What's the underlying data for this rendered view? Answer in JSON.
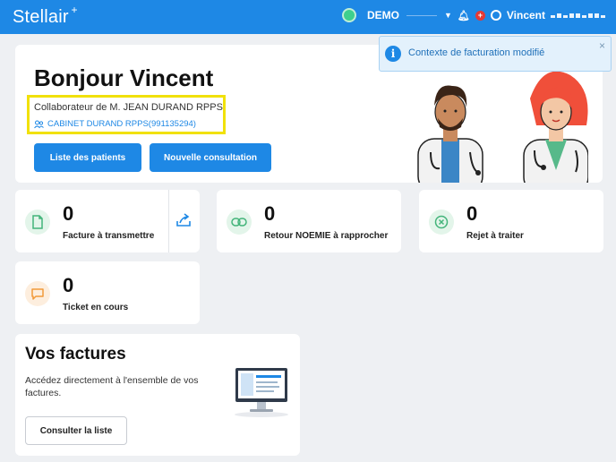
{
  "header": {
    "logo": "Stellair",
    "logo_spark": "+",
    "env_name": "DEMO",
    "user_name": "Vincent",
    "colors": {
      "bar": "#1e88e5",
      "env_dot": "#3ecf8e"
    }
  },
  "toast": {
    "text": "Contexte de facturation modifié",
    "close": "×"
  },
  "welcome": {
    "greeting": "Bonjour Vincent",
    "collaborator": "Collaborateur de M. JEAN DURAND RPPS",
    "cabinet": "CABINET DURAND RPPS(991135294)",
    "btn_patients": "Liste des patients",
    "btn_consultation": "Nouvelle consultation"
  },
  "stats": [
    {
      "value": "0",
      "label": "Facture à transmettre",
      "icon": "document-icon"
    },
    {
      "value": "0",
      "label": "Retour NOEMIE à rapprocher",
      "icon": "link-icon"
    },
    {
      "value": "0",
      "label": "Rejet à traiter",
      "icon": "cancel-icon"
    },
    {
      "value": "0",
      "label": "Ticket en cours",
      "icon": "message-icon"
    }
  ],
  "factures": {
    "title": "Vos factures",
    "description": "Accédez directement à l'ensemble de vos factures.",
    "button": "Consulter la liste"
  }
}
